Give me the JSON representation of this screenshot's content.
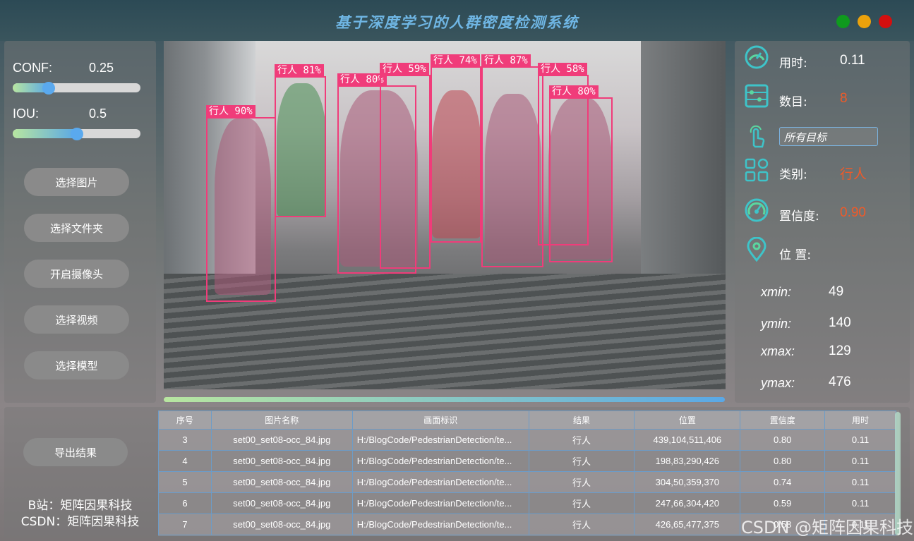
{
  "header": {
    "title": "基于深度学习的人群密度检测系统"
  },
  "controls": {
    "conf_label": "CONF:",
    "conf_value": "0.25",
    "conf_level": 0.28,
    "iou_label": "IOU:",
    "iou_value": "0.5",
    "iou_level": 0.5
  },
  "buttons": {
    "select_image": "选择图片",
    "select_folder": "选择文件夹",
    "open_camera": "开启摄像头",
    "select_video": "选择视频",
    "select_model": "选择模型",
    "export": "导出结果"
  },
  "detections": [
    {
      "label": "行人 90%"
    },
    {
      "label": "行人 81%"
    },
    {
      "label": "行人 80%"
    },
    {
      "label": "行人 59%"
    },
    {
      "label": "行人 74%"
    },
    {
      "label": "行人 87%"
    },
    {
      "label": "行人 58%"
    },
    {
      "label": "行人 80%"
    }
  ],
  "info": {
    "time_label": "用时:",
    "time_value": "0.11",
    "count_label": "数目:",
    "count_value": "8",
    "target_select": "所有目标",
    "class_label": "类别:",
    "class_value": "行人",
    "conf_label": "置信度:",
    "conf_value": "0.90",
    "position_label": "位 置:",
    "xmin_label": "xmin:",
    "xmin_value": "49",
    "ymin_label": "ymin:",
    "ymin_value": "140",
    "xmax_label": "xmax:",
    "xmax_value": "129",
    "ymax_label": "ymax:",
    "ymax_value": "476"
  },
  "credits": {
    "bilibili": "B站：矩阵因果科技",
    "csdn": "CSDN：矩阵因果科技"
  },
  "table": {
    "headers": [
      "序号",
      "图片名称",
      "画面标识",
      "结果",
      "位置",
      "置信度",
      "用时"
    ],
    "rows": [
      [
        "3",
        "set00_set08-occ_84.jpg",
        "H:/BlogCode/PedestrianDetection/te...",
        "行人",
        "439,104,511,406",
        "0.80",
        "0.11"
      ],
      [
        "4",
        "set00_set08-occ_84.jpg",
        "H:/BlogCode/PedestrianDetection/te...",
        "行人",
        "198,83,290,426",
        "0.80",
        "0.11"
      ],
      [
        "5",
        "set00_set08-occ_84.jpg",
        "H:/BlogCode/PedestrianDetection/te...",
        "行人",
        "304,50,359,370",
        "0.74",
        "0.11"
      ],
      [
        "6",
        "set00_set08-occ_84.jpg",
        "H:/BlogCode/PedestrianDetection/te...",
        "行人",
        "247,66,304,420",
        "0.59",
        "0.11"
      ],
      [
        "7",
        "set00_set08-occ_84.jpg",
        "H:/BlogCode/PedestrianDetection/te...",
        "行人",
        "426,65,477,375",
        "0.58",
        "0.11"
      ]
    ]
  },
  "watermark": "CSDN @矩阵因果科技",
  "colors": {
    "accent": "#5aa9ee",
    "value_orange": "#f05a28",
    "detection_box": "#f03c7a"
  }
}
